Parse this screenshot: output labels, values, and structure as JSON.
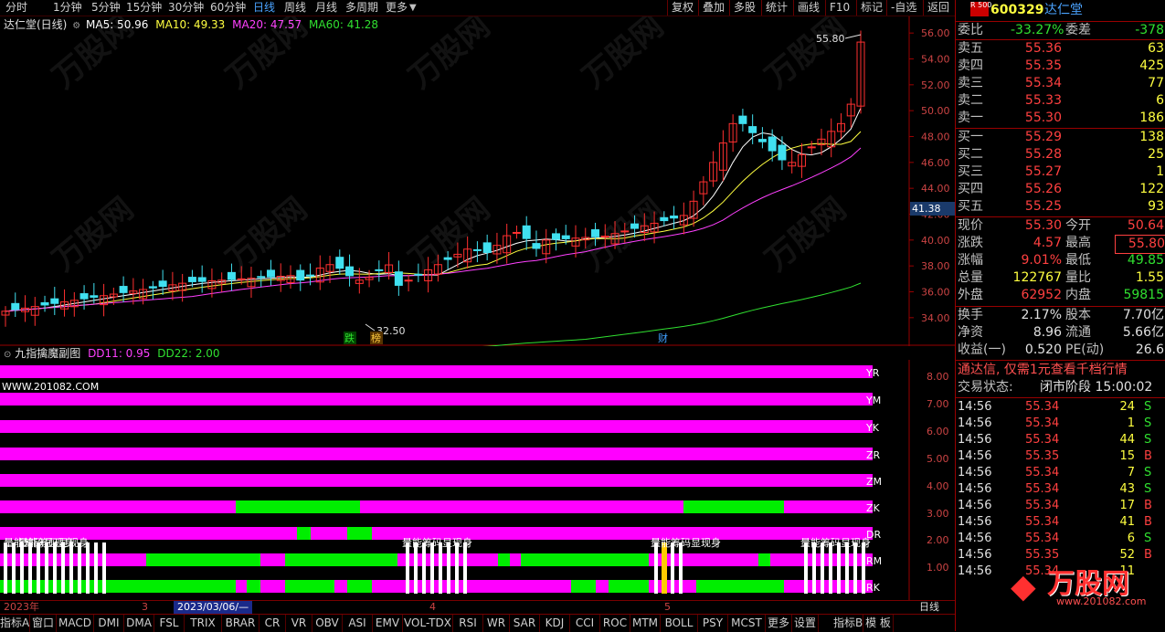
{
  "topbar": {
    "tabs": [
      "分时",
      "1分钟",
      "5分钟",
      "15分钟",
      "30分钟",
      "60分钟",
      "日线",
      "周线",
      "月线",
      "多周期",
      "更多"
    ],
    "active": "日线",
    "right_tabs": [
      "复权",
      "叠加",
      "多股",
      "统计",
      "画线",
      "F10",
      "标记",
      "-自选",
      "返回"
    ]
  },
  "main_legend": {
    "title": "达仁堂(日线)",
    "ma5": "MA5: 50.96",
    "ma10": "MA10: 49.33",
    "ma20": "MA20: 47.57",
    "ma60": "MA60: 41.28"
  },
  "main_axis": {
    "labels": [
      "56.00",
      "54.00",
      "52.00",
      "50.00",
      "48.00",
      "46.00",
      "44.00",
      "42.00",
      "40.00",
      "38.00",
      "36.00",
      "34.00"
    ],
    "highlight": "41.38",
    "range": [
      33.0,
      57.0
    ]
  },
  "annotations": {
    "high": "55.80",
    "low": "32.50",
    "tag_die": "跌",
    "tag_bang": "榜",
    "tag_cai": "财"
  },
  "sub_legend": {
    "title": "九指擒魔副图",
    "dd11": "DD11: 0.95",
    "dd22": "DD22: 2.00"
  },
  "sub_axis": {
    "labels": [
      "8.00",
      "7.00",
      "6.00",
      "5.00",
      "4.00",
      "3.00",
      "2.00",
      "1.00"
    ],
    "row_labels": [
      "YR",
      "YM",
      "YK",
      "ZR",
      "ZM",
      "ZK",
      "DR",
      "RM",
      "RK"
    ],
    "website": "WWW.201082.COM",
    "overlay": "量能筹码显现身"
  },
  "date_axis": {
    "year": "2023年",
    "m3": "3",
    "date": "2023/03/06/—",
    "m4": "4",
    "m5": "5",
    "period": "日线"
  },
  "bottombar": [
    "指标A",
    "窗口",
    "MACD",
    "DMI",
    "DMA",
    "FSL",
    "TRIX",
    "BRAR",
    "CR",
    "VR",
    "OBV",
    "ASI",
    "EMV",
    "VOL-TDX",
    "RSI",
    "WR",
    "SAR",
    "KDJ",
    "CCI",
    "ROC",
    "MTM",
    "BOLL",
    "PSY",
    "MCST",
    "更多",
    "设置",
    "指标B",
    "模 板"
  ],
  "quote": {
    "badge": "R 500",
    "code": "600329",
    "name": "达仁堂",
    "weibi_label": "委比",
    "weibi": "-33.27%",
    "weicha_label": "委差",
    "weicha": "-378",
    "asks": [
      {
        "label": "卖五",
        "price": "55.36",
        "vol": "63"
      },
      {
        "label": "卖四",
        "price": "55.35",
        "vol": "425"
      },
      {
        "label": "卖三",
        "price": "55.34",
        "vol": "77"
      },
      {
        "label": "卖二",
        "price": "55.33",
        "vol": "6"
      },
      {
        "label": "卖一",
        "price": "55.30",
        "vol": "186"
      }
    ],
    "bids": [
      {
        "label": "买一",
        "price": "55.29",
        "vol": "138"
      },
      {
        "label": "买二",
        "price": "55.28",
        "vol": "25"
      },
      {
        "label": "买三",
        "price": "55.27",
        "vol": "1"
      },
      {
        "label": "买四",
        "price": "55.26",
        "vol": "122"
      },
      {
        "label": "买五",
        "price": "55.25",
        "vol": "93"
      }
    ],
    "stats": [
      {
        "l1": "现价",
        "v1": "55.30",
        "l2": "今开",
        "v2": "50.64"
      },
      {
        "l1": "涨跌",
        "v1": "4.57",
        "l2": "最高",
        "v2": "55.80"
      },
      {
        "l1": "涨幅",
        "v1": "9.01%",
        "l2": "最低",
        "v2": "49.85"
      },
      {
        "l1": "总量",
        "v1": "122767",
        "l2": "量比",
        "v2": "1.55"
      },
      {
        "l1": "外盘",
        "v1": "62952",
        "l2": "内盘",
        "v2": "59815"
      }
    ],
    "stats2": [
      {
        "l1": "换手",
        "v1": "2.17%",
        "l2": "股本",
        "v2": "7.70亿"
      },
      {
        "l1": "净资",
        "v1": "8.96",
        "l2": "流通",
        "v2": "5.66亿"
      },
      {
        "l1": "收益(一)",
        "v1": "0.520",
        "l2": "PE(动)",
        "v2": "26.6"
      }
    ],
    "promo": "通达信, 仅需1元查看千档行情",
    "status_label": "交易状态:",
    "status": "闭市阶段 15:00:02",
    "ticks": [
      {
        "t": "14:56",
        "p": "55.34",
        "v": "24",
        "s": "S"
      },
      {
        "t": "14:56",
        "p": "55.34",
        "v": "1",
        "s": "S"
      },
      {
        "t": "14:56",
        "p": "55.34",
        "v": "44",
        "s": "S"
      },
      {
        "t": "14:56",
        "p": "55.35",
        "v": "15",
        "s": "B"
      },
      {
        "t": "14:56",
        "p": "55.34",
        "v": "7",
        "s": "S"
      },
      {
        "t": "14:56",
        "p": "55.34",
        "v": "43",
        "s": "S"
      },
      {
        "t": "14:56",
        "p": "55.34",
        "v": "17",
        "s": "B"
      },
      {
        "t": "14:56",
        "p": "55.34",
        "v": "41",
        "s": "B"
      },
      {
        "t": "14:56",
        "p": "55.34",
        "v": "6",
        "s": "S"
      },
      {
        "t": "14:56",
        "p": "55.35",
        "v": "52",
        "s": "B"
      },
      {
        "t": "14:56",
        "p": "55.34",
        "v": "11",
        "s": ""
      }
    ],
    "watermark": "万股网",
    "watermark_url": "www.201082.com"
  },
  "colors": {
    "up": "#ff3030",
    "down": "#40e0f0",
    "ma5": "#ffffff",
    "ma10": "#ffff40",
    "ma20": "#ff40ff",
    "ma60": "#30e030",
    "magenta": "#ff00ff",
    "green": "#00ee00"
  }
}
